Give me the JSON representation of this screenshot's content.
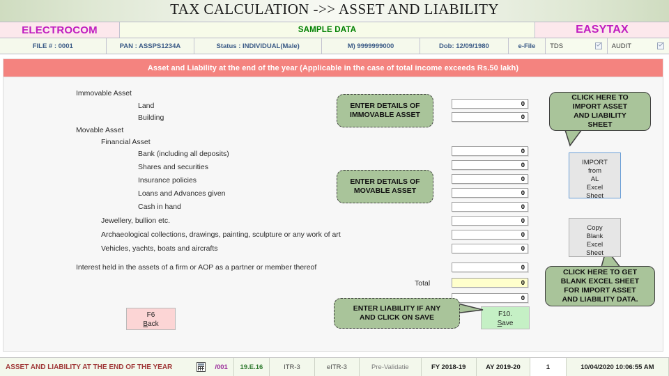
{
  "header": {
    "title": "TAX CALCULATION ->> ASSET AND LIABILITY",
    "brand_left": "ELECTROCOM",
    "brand_center": "SAMPLE DATA",
    "brand_right": "EASYTAX",
    "info": {
      "file": "FILE # : 0001",
      "pan": "PAN : ASSPS1234A",
      "status": "Status : INDIVIDUAL(Male)",
      "mobile": "M) 9999999000",
      "dob": "Dob: 12/09/1980",
      "efile": "e-File",
      "tds": "TDS",
      "audit": "AUDIT"
    }
  },
  "banner": {
    "text": "Asset and Liability at the end of the year (Applicable in the case of total income exceeds Rs.50 lakh)"
  },
  "form": {
    "labels": {
      "immovable_asset": "Immovable Asset",
      "land": "Land",
      "building": "Building",
      "movable_asset": "Movable Asset",
      "financial_asset": "Financial Asset",
      "bank": "Bank (including all deposits)",
      "shares": "Shares and securities",
      "insurance": "Insurance policies",
      "loans": "Loans and Advances given",
      "cash": "Cash in hand",
      "jewellery": "Jewellery, bullion etc.",
      "archaeological": "Archaeological collections, drawings, painting, sculpture or any work of art",
      "vehicles": "Vehicles, yachts, boats and aircrafts",
      "interest_firm": "Interest held in the assets of a firm or AOP as a partner or member thereof",
      "total": "Total"
    },
    "values": {
      "land": "0",
      "building": "0",
      "bank": "0",
      "shares": "0",
      "insurance": "0",
      "loans": "0",
      "cash": "0",
      "jewellery": "0",
      "archaeological": "0",
      "vehicles": "0",
      "interest_firm": "0",
      "total": "0",
      "liability": "0"
    }
  },
  "callouts": {
    "immovable": "ENTER DETAILS OF\nIMMOVABLE ASSET",
    "immovable_line1": "ENTER DETAILS OF",
    "immovable_line2": "IMMOVABLE ASSET",
    "movable_line1": "ENTER DETAILS OF",
    "movable_line2": "MOVABLE ASSET",
    "import_line1": "CLICK HERE TO",
    "import_line2": "IMPORT ASSET",
    "import_line3": "AND LIABILITY",
    "import_line4": "SHEET",
    "blank_line1": "CLICK HERE TO GET",
    "blank_line2": "BLANK EXCEL SHEET",
    "blank_line3": "FOR IMPORT ASSET",
    "blank_line4": "AND LIABILITY DATA.",
    "liability_line1": "ENTER LIABILITY IF ANY",
    "liability_line2": "AND CLICK ON SAVE"
  },
  "buttons": {
    "import_l1": "IMPORT",
    "import_l2": "from",
    "import_l3": "AL",
    "import_l4": "Excel",
    "import_l5": "Sheet",
    "copy_l1": "Copy",
    "copy_l2": "Blank",
    "copy_l3": "Excel",
    "copy_l4": "Sheet",
    "back_key": "F6",
    "back_label_a": "B",
    "back_label_b": "ack",
    "save_key": "F10.",
    "save_label_a": "S",
    "save_label_b": "ave"
  },
  "statusbar": {
    "title": "ASSET AND LIABILITY AT THE END OF THE YEAR",
    "file_no": "/001",
    "version": "19.E.16",
    "itr": "ITR-3",
    "eitr": "eITR-3",
    "prevalidate": "Pre-Validatie",
    "fy": "FY 2018-19",
    "ay": "AY 2019-20",
    "count": "1",
    "datetime": "10/04/2020 10:06:55 AM",
    "dash": "--"
  },
  "colors": {
    "banner": "#f4837f",
    "callout": "#a9c49a",
    "brand_text": "#c01cc0",
    "total_highlight": "#ffffcc"
  }
}
